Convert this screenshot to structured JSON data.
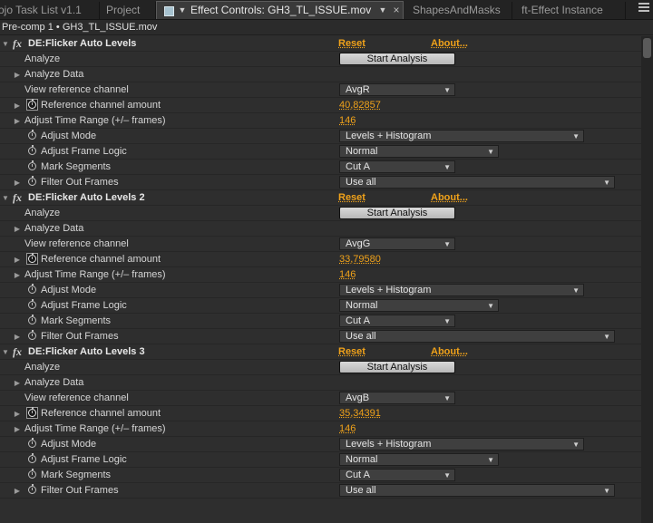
{
  "tabs": [
    {
      "label": "ojo Task List v1.1"
    },
    {
      "label": "Project"
    },
    {
      "label": "Effect Controls: GH3_TL_ISSUE.mov"
    },
    {
      "label": "ShapesAndMasks"
    },
    {
      "label": "ft-Effect Instance"
    }
  ],
  "tab_close_glyph": "×",
  "breadcrumb": "Pre-comp 1 • GH3_TL_ISSUE.mov",
  "accent_color": "#f0a21a",
  "effects": [
    {
      "name": "DE:Flicker Auto Levels",
      "reset": "Reset",
      "about": "About...",
      "analyze": "Analyze",
      "analyze_button": "Start Analysis",
      "analyze_data": "Analyze Data",
      "view_ref": "View reference channel",
      "view_ref_value": "AvgR",
      "ref_amount": "Reference channel amount",
      "ref_amount_value": "40,82857",
      "time_range": "Adjust Time Range (+/– frames)",
      "time_range_value": "146",
      "adjust_mode": "Adjust Mode",
      "adjust_mode_value": "Levels + Histogram",
      "frame_logic": "Adjust Frame Logic",
      "frame_logic_value": "Normal",
      "mark_segments": "Mark Segments",
      "mark_segments_value": "Cut A",
      "filter_frames": "Filter Out Frames",
      "filter_frames_value": "Use all"
    },
    {
      "name": "DE:Flicker Auto Levels 2",
      "reset": "Reset",
      "about": "About...",
      "analyze": "Analyze",
      "analyze_button": "Start Analysis",
      "analyze_data": "Analyze Data",
      "view_ref": "View reference channel",
      "view_ref_value": "AvgG",
      "ref_amount": "Reference channel amount",
      "ref_amount_value": "33,79580",
      "time_range": "Adjust Time Range (+/– frames)",
      "time_range_value": "146",
      "adjust_mode": "Adjust Mode",
      "adjust_mode_value": "Levels + Histogram",
      "frame_logic": "Adjust Frame Logic",
      "frame_logic_value": "Normal",
      "mark_segments": "Mark Segments",
      "mark_segments_value": "Cut A",
      "filter_frames": "Filter Out Frames",
      "filter_frames_value": "Use all"
    },
    {
      "name": "DE:Flicker Auto Levels 3",
      "reset": "Reset",
      "about": "About...",
      "analyze": "Analyze",
      "analyze_button": "Start Analysis",
      "analyze_data": "Analyze Data",
      "view_ref": "View reference channel",
      "view_ref_value": "AvgB",
      "ref_amount": "Reference channel amount",
      "ref_amount_value": "35,34391",
      "time_range": "Adjust Time Range (+/– frames)",
      "time_range_value": "146",
      "adjust_mode": "Adjust Mode",
      "adjust_mode_value": "Levels + Histogram",
      "frame_logic": "Adjust Frame Logic",
      "frame_logic_value": "Normal",
      "mark_segments": "Mark Segments",
      "mark_segments_value": "Cut A",
      "filter_frames": "Filter Out Frames",
      "filter_frames_value": "Use all"
    }
  ]
}
